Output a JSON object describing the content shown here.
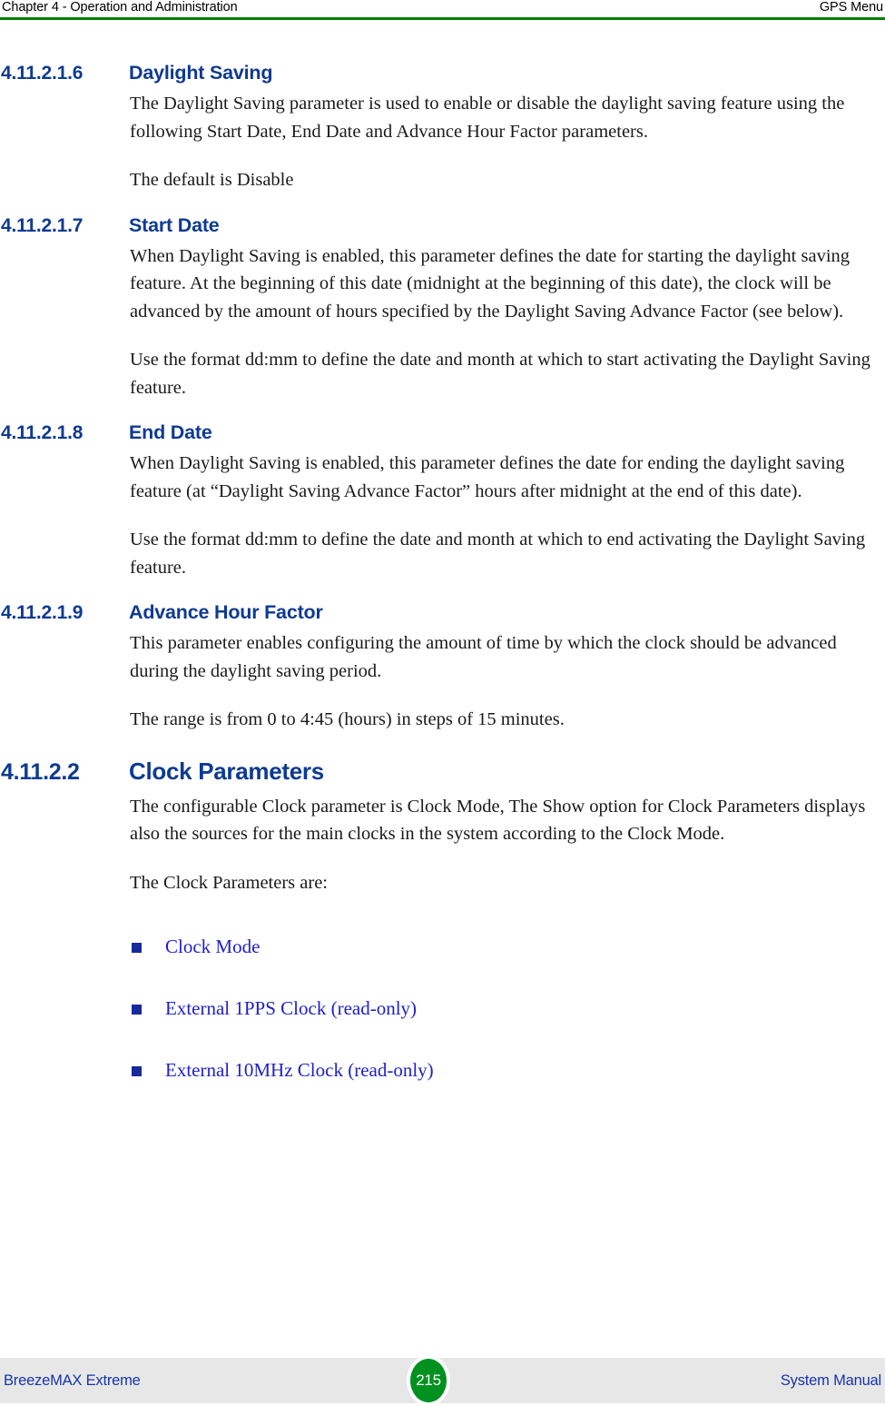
{
  "header": {
    "left": "Chapter 4 - Operation and Administration",
    "right": "GPS Menu",
    "rule_color": "#008000"
  },
  "theme": {
    "heading_color": "#0e3a91",
    "link_color": "#2020cc",
    "bullet_color": "#162a99",
    "footer_bg": "#e7e7e7",
    "footer_text_color": "#1536a8",
    "page_badge_color": "#00911f"
  },
  "sections": [
    {
      "number": "4.11.2.1.6",
      "title": "Daylight Saving",
      "level": 4,
      "paragraphs": [
        "The Daylight Saving parameter is used to enable or disable the daylight saving feature using the following Start Date, End Date and Advance Hour Factor parameters.",
        "The default is Disable"
      ]
    },
    {
      "number": "4.11.2.1.7",
      "title": "Start Date",
      "level": 4,
      "paragraphs": [
        "When Daylight Saving is enabled, this parameter defines the date for starting the daylight saving feature. At the beginning of this date (midnight at the beginning of this date), the clock will be advanced by the amount of hours specified by the Daylight Saving Advance Factor (see below).",
        "Use the format dd:mm to define the date and month at which to start activating the Daylight Saving feature."
      ]
    },
    {
      "number": "4.11.2.1.8",
      "title": "End Date",
      "level": 4,
      "paragraphs": [
        "When Daylight Saving is enabled, this parameter defines the date for ending the daylight saving feature (at “Daylight Saving Advance Factor” hours after midnight at the end of this date).",
        "Use the format dd:mm to define the date and month at which to end activating the Daylight Saving feature."
      ]
    },
    {
      "number": "4.11.2.1.9",
      "title": "Advance Hour Factor",
      "level": 4,
      "paragraphs": [
        "This parameter enables configuring the amount of time by which the clock should be advanced during the daylight saving period.",
        "The range is from 0 to 4:45 (hours) in steps of 15 minutes."
      ]
    },
    {
      "number": "4.11.2.2",
      "title": "Clock Parameters",
      "level": 3,
      "paragraphs": [
        "The configurable Clock parameter is Clock Mode, The Show option for Clock Parameters displays also the sources for the main clocks in the system according to the Clock Mode.",
        "The Clock Parameters are:"
      ],
      "links": [
        "Clock Mode",
        "External 1PPS Clock (read-only)",
        "External 10MHz Clock (read-only)"
      ]
    }
  ],
  "footer": {
    "left": "BreezeMAX Extreme",
    "page": "215",
    "right": "System Manual"
  }
}
